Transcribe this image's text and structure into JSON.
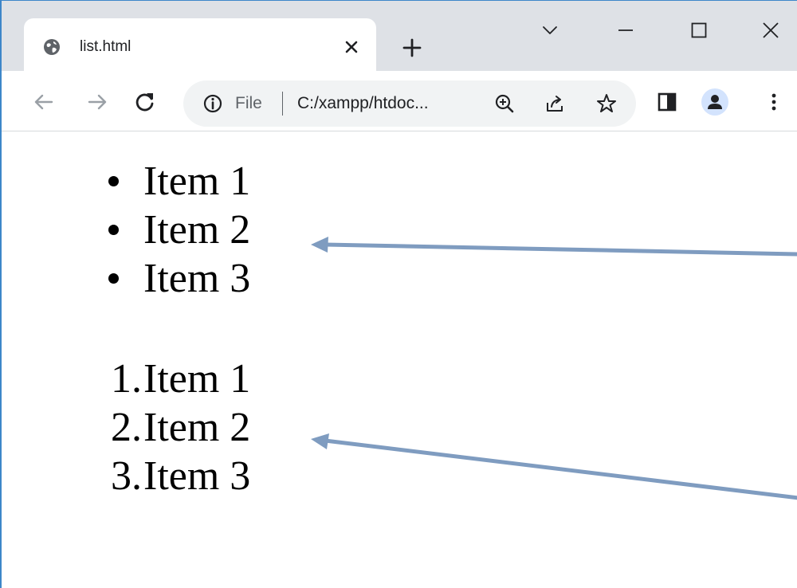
{
  "browser": {
    "tab": {
      "title": "list.html",
      "favicon": "globe-icon"
    },
    "toolbar": {
      "scheme_label": "File",
      "url": "C:/xampp/htdoc..."
    },
    "window_controls": [
      "chevron-down-icon",
      "minimize-icon",
      "maximize-icon",
      "close-icon"
    ]
  },
  "page": {
    "unordered_list": {
      "items": [
        "Item 1",
        "Item 2",
        "Item 3"
      ]
    },
    "ordered_list": {
      "items": [
        {
          "number": "1.",
          "label": "Item 1"
        },
        {
          "number": "2.",
          "label": "Item 2"
        },
        {
          "number": "3.",
          "label": "Item 3"
        }
      ]
    }
  },
  "colors": {
    "tabstrip_bg": "#dee1e6",
    "omnibox_bg": "#f1f3f4",
    "annotation_arrow": "#7f9cc0",
    "window_border": "#3d86c9"
  }
}
